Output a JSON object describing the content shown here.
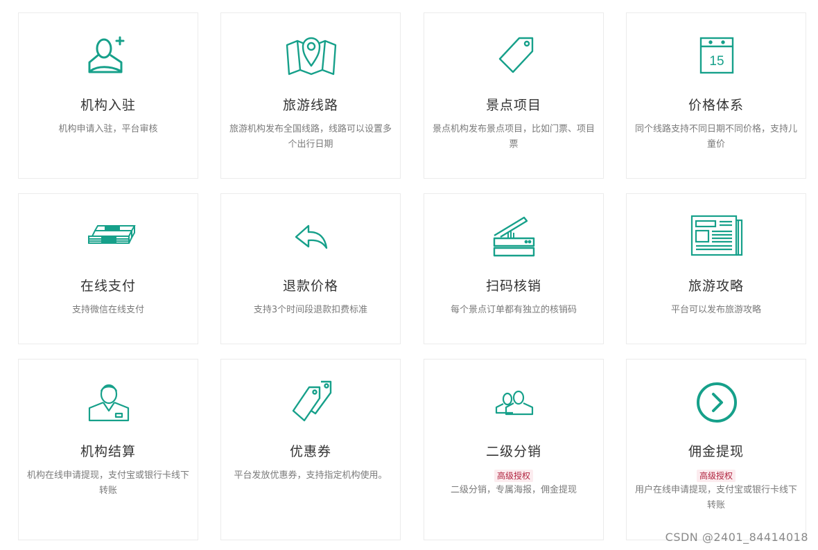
{
  "accent_color": "#16a08a",
  "cards": [
    {
      "icon": "user-add-icon",
      "title": "机构入驻",
      "desc": "机构申请入驻，平台审核"
    },
    {
      "icon": "map-pin-icon",
      "title": "旅游线路",
      "desc": "旅游机构发布全国线路，线路可以设置多个出行日期"
    },
    {
      "icon": "tag-icon",
      "title": "景点项目",
      "desc": "景点机构发布景点项目，比如门票、项目票"
    },
    {
      "icon": "calendar-icon",
      "title": "价格体系",
      "calendar_day": "15",
      "desc": "同个线路支持不同日期不同价格，支持儿童价"
    },
    {
      "icon": "money-stack-icon",
      "title": "在线支付",
      "desc": "支持微信在线支付"
    },
    {
      "icon": "reply-arrow-icon",
      "title": "退款价格",
      "desc": "支持3个时间段退款扣费标准"
    },
    {
      "icon": "scanner-icon",
      "title": "扫码核销",
      "desc": "每个景点订单都有独立的核销码"
    },
    {
      "icon": "newspaper-icon",
      "title": "旅游攻略",
      "desc": "平台可以发布旅游攻略"
    },
    {
      "icon": "agent-icon",
      "title": "机构结算",
      "desc": "机构在线申请提现，支付宝或银行卡线下转账"
    },
    {
      "icon": "coupon-tags-icon",
      "title": "优惠券",
      "desc": "平台发放优惠券，支持指定机构使用。"
    },
    {
      "icon": "users-icon",
      "title": "二级分销",
      "badge": "高级授权",
      "desc": "二级分销，专属海报，佣金提现"
    },
    {
      "icon": "chevron-circle-icon",
      "title": "佣金提现",
      "badge": "高级授权",
      "desc": "用户在线申请提现，支付宝或银行卡线下转账"
    }
  ],
  "watermark": "CSDN @2401_84414018"
}
